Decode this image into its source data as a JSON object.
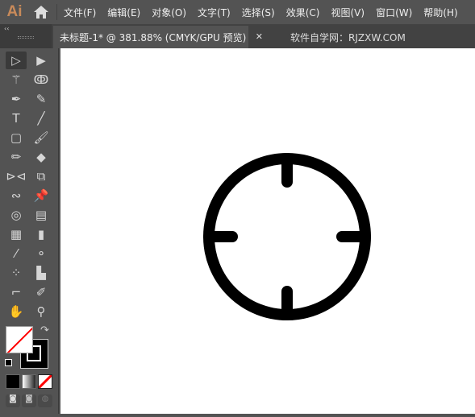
{
  "app": {
    "logo": "Ai",
    "home_icon": "home-icon"
  },
  "menu": [
    "文件(F)",
    "编辑(E)",
    "对象(O)",
    "文字(T)",
    "选择(S)",
    "效果(C)",
    "视图(V)",
    "窗口(W)",
    "帮助(H)"
  ],
  "tabs": [
    {
      "label": "未标题-1* @ 381.88% (CMYK/GPU 预览)",
      "active": true,
      "close": "✕"
    },
    {
      "label": "软件自学网：RJZXW.COM",
      "active": false
    }
  ],
  "panel": {
    "collapse": "‹‹"
  },
  "tools": [
    {
      "name": "selection-tool",
      "glyph": "▷"
    },
    {
      "name": "direct-selection-tool",
      "glyph": "▶"
    },
    {
      "name": "magic-wand-tool",
      "glyph": "⚚"
    },
    {
      "name": "lasso-tool",
      "glyph": "ↂ"
    },
    {
      "name": "pen-tool",
      "glyph": "✒"
    },
    {
      "name": "curvature-tool",
      "glyph": "✎"
    },
    {
      "name": "type-tool",
      "glyph": "T"
    },
    {
      "name": "line-tool",
      "glyph": "╱"
    },
    {
      "name": "rectangle-tool",
      "glyph": "▢"
    },
    {
      "name": "paintbrush-tool",
      "glyph": "🖌"
    },
    {
      "name": "shaper-tool",
      "glyph": "✏"
    },
    {
      "name": "eraser-tool",
      "glyph": "◆"
    },
    {
      "name": "reflect-tool",
      "glyph": "⊳⊲"
    },
    {
      "name": "scale-tool",
      "glyph": "⧉"
    },
    {
      "name": "warp-tool",
      "glyph": "∾"
    },
    {
      "name": "puppet-warp-tool",
      "glyph": "📌"
    },
    {
      "name": "shape-builder-tool",
      "glyph": "◎"
    },
    {
      "name": "perspective-grid-tool",
      "glyph": "▤"
    },
    {
      "name": "mesh-tool",
      "glyph": "▦"
    },
    {
      "name": "gradient-tool",
      "glyph": "▮"
    },
    {
      "name": "eyedropper-tool",
      "glyph": "⁄"
    },
    {
      "name": "blend-tool",
      "glyph": "⚬"
    },
    {
      "name": "symbol-sprayer-tool",
      "glyph": "⁘"
    },
    {
      "name": "column-graph-tool",
      "glyph": "▙"
    },
    {
      "name": "artboard-tool",
      "glyph": "⌐"
    },
    {
      "name": "slice-tool",
      "glyph": "✐"
    },
    {
      "name": "hand-tool",
      "glyph": "✋"
    },
    {
      "name": "zoom-tool",
      "glyph": "⚲"
    }
  ],
  "colors": {
    "fill": "#ffffff",
    "stroke": "#000000",
    "none_slash": "#ff0000",
    "canvas": "#ffffff",
    "ui": "#535353"
  },
  "swap_icon": "↷",
  "artwork": {
    "shape": "crosshair-circle",
    "color": "#000000"
  }
}
